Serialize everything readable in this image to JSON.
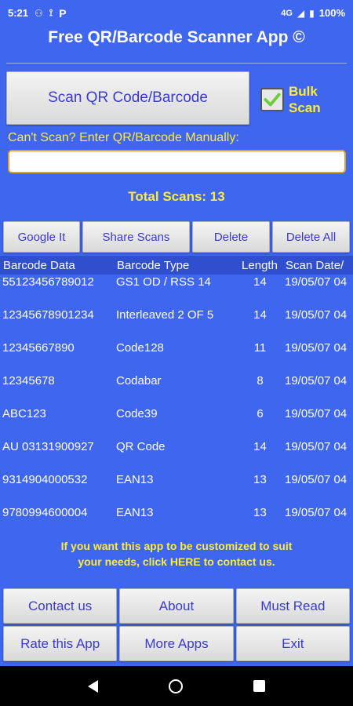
{
  "status": {
    "time": "5:21",
    "battery": "100%",
    "signal": "4G",
    "left_icons": [
      "voicemail-icon",
      "usb-icon",
      "parking-icon"
    ],
    "right_icons": [
      "signal-icon",
      "battery-icon"
    ]
  },
  "title": "Free QR/Barcode Scanner App ©",
  "scan_button": "Scan QR Code/Barcode",
  "bulk_scan": {
    "label_line1": "Bulk",
    "label_line2": "Scan",
    "checked": true
  },
  "manual": {
    "label": "Can't Scan? Enter QR/Barcode Manually:",
    "value": "",
    "placeholder": ""
  },
  "total_scans": "Total Scans: 13",
  "actions": [
    "Google It",
    "Share Scans",
    "Delete",
    "Delete All"
  ],
  "table": {
    "headers": [
      "Barcode Data",
      "Barcode Type",
      "Length",
      "Scan Date/"
    ],
    "rows": [
      [
        "55123456789012",
        "GS1 OD / RSS 14",
        "14",
        "19/05/07 04"
      ],
      [
        "12345678901234",
        "Interleaved 2 OF 5",
        "14",
        "19/05/07 04"
      ],
      [
        "12345667890",
        "Code128",
        "11",
        "19/05/07 04"
      ],
      [
        "12345678",
        "Codabar",
        "8",
        "19/05/07 04"
      ],
      [
        "ABC123",
        "Code39",
        "6",
        "19/05/07 04"
      ],
      [
        "AU 03131900927",
        "QR Code",
        "14",
        "19/05/07 04"
      ],
      [
        "9314904000532",
        "EAN13",
        "13",
        "19/05/07 04"
      ],
      [
        "9780994600004",
        "EAN13",
        "13",
        "19/05/07 04"
      ]
    ]
  },
  "note_line1": "If you want this app to be customized to suit",
  "note_line2": "your needs, click HERE to contact us.",
  "bottom_buttons": {
    "contact": "Contact us",
    "about": "About",
    "must_read": "Must Read",
    "rate": "Rate this App",
    "more_apps": "More Apps",
    "exit": "Exit"
  },
  "colors": {
    "background": "#3f66ef",
    "accent_text": "#ffeb3b",
    "button_text": "#3a3ad0",
    "checkmark": "#6ccf3a"
  }
}
